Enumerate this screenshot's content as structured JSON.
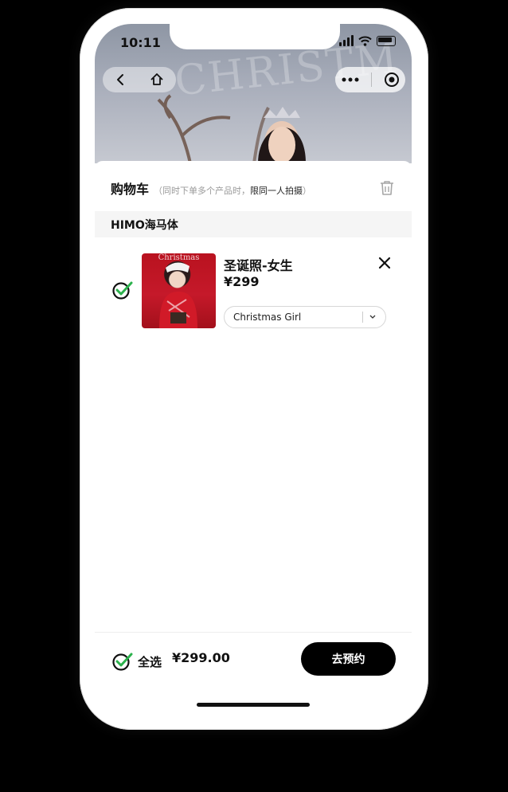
{
  "status": {
    "time": "10:11"
  },
  "hero": {
    "banner_text": "CHRISTM"
  },
  "cart": {
    "title": "购物车",
    "note_prefix": "（同时下单多个产品时，",
    "note_emphasis": "限同一人拍摄",
    "note_suffix": "）"
  },
  "store": {
    "name": "HIMO海马体"
  },
  "item": {
    "title": "圣诞照-女生",
    "price": "¥299",
    "option_selected": "Christmas Girl",
    "thumb_caption": "Christmas"
  },
  "footer": {
    "select_all_label": "全选",
    "total": "¥299.00",
    "book_button": "去预约"
  },
  "colors": {
    "check_green": "#2bb24c",
    "primary_black": "#000000"
  }
}
